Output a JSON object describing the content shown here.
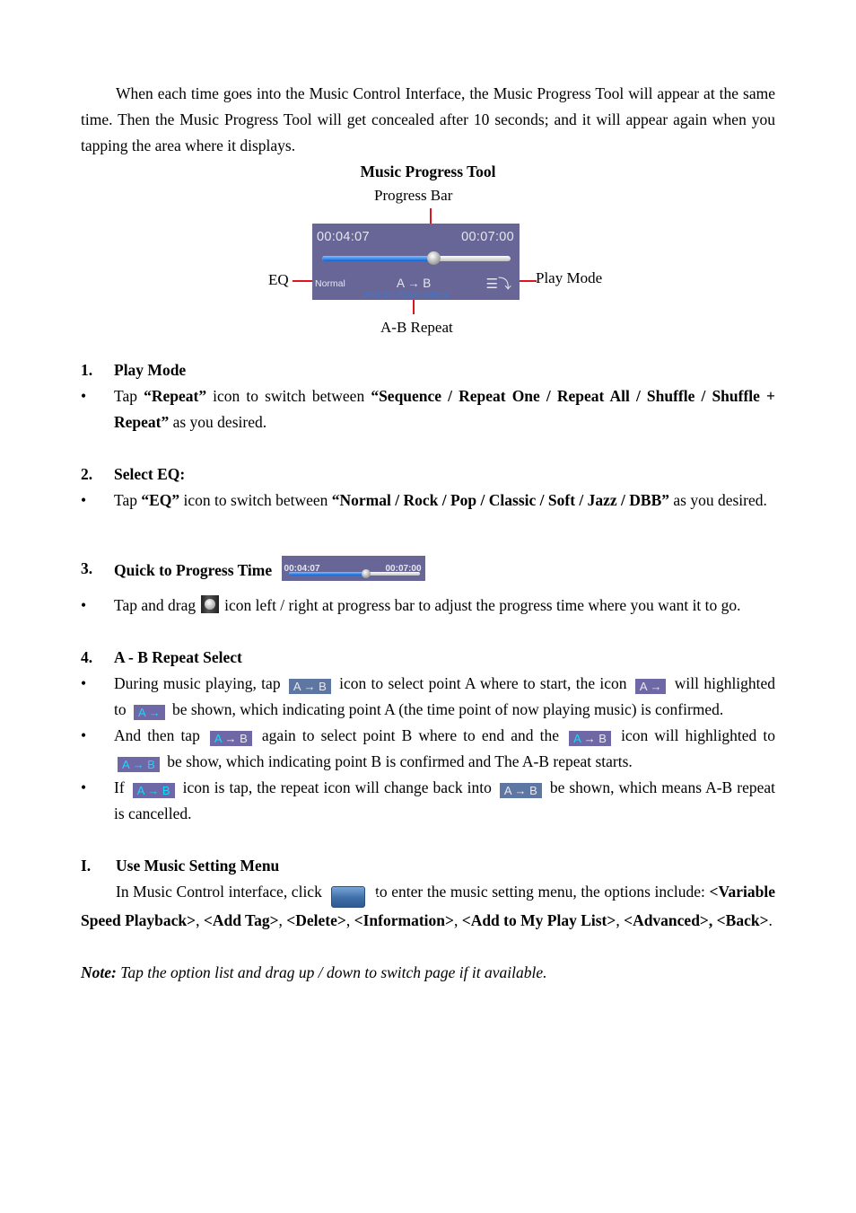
{
  "intro": {
    "paragraph": "When each time goes into the Music Control Interface, the Music Progress Tool will appear at the same time. Then the Music Progress Tool will get concealed after 10 seconds; and it will appear again when you tapping the area where it displays."
  },
  "figure": {
    "title": "Music Progress Tool",
    "labels": {
      "progress_bar": "Progress Bar",
      "eq": "EQ",
      "play_mode": "Play Mode",
      "ab_repeat": "A-B Repeat"
    },
    "player": {
      "current_time": "00:04:07",
      "total_time": "00:07:00",
      "progress_fraction": 0.59,
      "eq_value": "Normal",
      "ab_label": "A → B",
      "play_mode_icon": "repeat-list-icon",
      "lyric": "And still those voices",
      "colors": {
        "panel": "#676696",
        "progress": "#1a6fe0"
      }
    }
  },
  "sections": [
    {
      "number": "1.",
      "title": "Play Mode",
      "bullets": [
        {
          "pre": "Tap ",
          "b1": "“Repeat”",
          "mid": " icon to switch between ",
          "b2": "“Sequence / Repeat One / Repeat All / Shuffle / Shuffle + Repeat”",
          "post": " as you desired."
        }
      ]
    },
    {
      "number": "2.",
      "title": "Select EQ:",
      "bullets": [
        {
          "pre": "Tap ",
          "b1": "“EQ”",
          "mid": " icon to switch between ",
          "b2": "“Normal / Rock / Pop / Classic / Soft / Jazz / DBB”",
          "post": " as you desired."
        }
      ]
    },
    {
      "number": "3.",
      "title": "Quick to Progress Time",
      "mini_bar": {
        "current_time": "00:04:07",
        "total_time": "00:07:00",
        "progress_fraction": 0.59
      },
      "bullets": [
        {
          "pre": "Tap and drag",
          "post": "icon left / right at progress bar to adjust the progress time where you want it to go."
        }
      ]
    },
    {
      "number": "4.",
      "title": "A - B Repeat Select",
      "icons": {
        "ab": "A → B",
        "a_only": "A →",
        "a": "A",
        "b": "B",
        "arrow": "→"
      },
      "bullets": [
        {
          "t1": "During music playing, tap",
          "t2": "icon to select point A where to start, the icon",
          "t3": "will highlighted to",
          "t4": "be shown, which indicating point A (the time point of now playing music) is confirmed."
        },
        {
          "t1": "And then tap",
          "t2": "again to select point B where to end and the",
          "t3": "icon will highlighted to",
          "t4": "be show, which indicating point B is confirmed and The A-B repeat starts."
        },
        {
          "t1": "If",
          "t2": "icon is tap, the repeat icon will change back into",
          "t3": "be shown, which means A-B repeat is cancelled."
        }
      ]
    }
  ],
  "settings": {
    "number": "I.",
    "title": "Use Music Setting Menu",
    "pre": "In Music Control interface, click",
    "post": "to enter the music setting menu, the options include:",
    "options": [
      "<Variable Speed Playback>",
      "<Add Tag>",
      "<Delete>",
      "<Information>",
      "<Add to My Play List>",
      "<Advanced>",
      "<Back>"
    ],
    "gear_icon": "⚙"
  },
  "note": {
    "label": "Note:",
    "text": " Tap the option list and drag up / down to switch page if it available."
  }
}
